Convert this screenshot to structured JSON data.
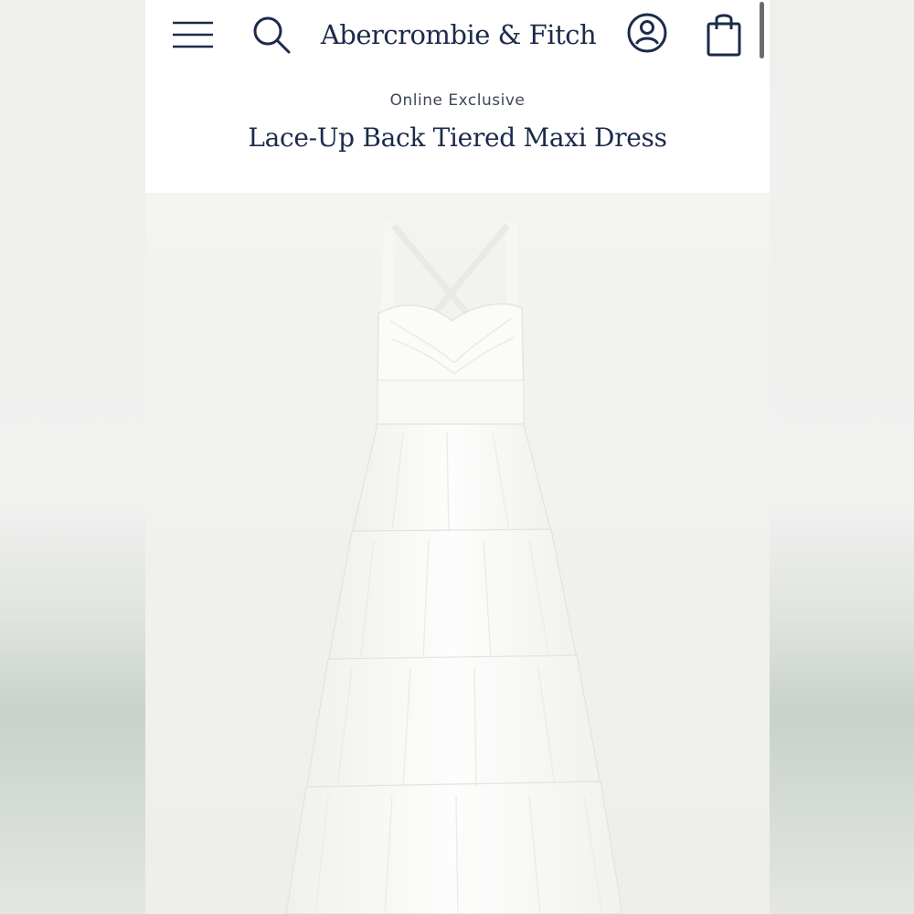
{
  "header": {
    "brand": "Abercrombie & Fitch",
    "icons": {
      "menu": "hamburger-menu-icon",
      "search": "search-icon",
      "account": "account-icon",
      "bag": "shopping-bag-icon"
    }
  },
  "product": {
    "badge": "Online Exclusive",
    "title": "Lace-Up Back Tiered Maxi Dress",
    "image_alt": "White tiered maxi dress with cross straps"
  },
  "colors": {
    "brand_navy": "#1c2b4a",
    "page_bg": "#ffffff",
    "dress_white": "#fbfbfa"
  }
}
